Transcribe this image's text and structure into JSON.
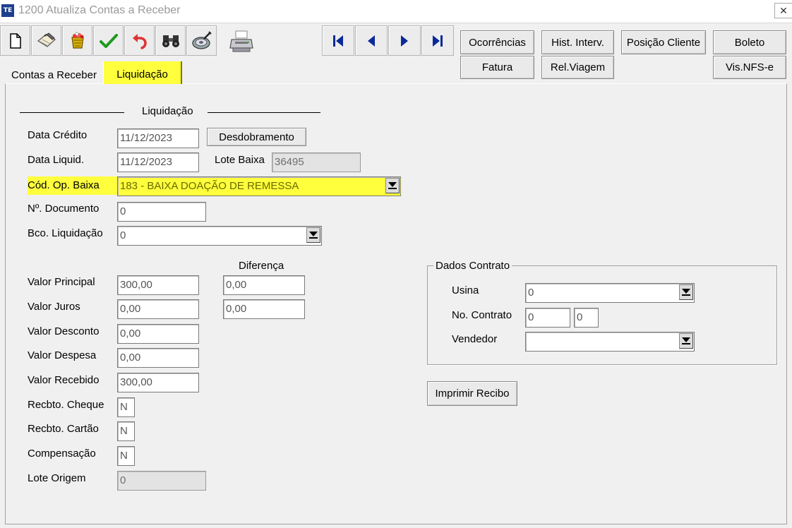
{
  "window": {
    "app_icon_text": "TE",
    "title": "1200 Atualiza Contas a Receber",
    "close_symbol": "✕"
  },
  "toolbar": {
    "icons": [
      "new-document-icon",
      "edit-notepad-icon",
      "delete-basket-icon",
      "confirm-check-icon",
      "undo-arrow-icon",
      "search-binoculars-icon",
      "cancel-disk-icon",
      "print-printer-icon"
    ],
    "nav_icons": [
      "first-record-icon",
      "previous-record-icon",
      "next-record-icon",
      "last-record-icon"
    ]
  },
  "actions": {
    "ocorrencias": "Ocorrências",
    "hist_interv": "Hist. Interv.",
    "posicao_cliente": "Posição Cliente",
    "boleto": "Boleto",
    "fatura": "Fatura",
    "rel_viagem": "Rel.Viagem",
    "vis_nfse": "Vis.NFS-e"
  },
  "tabs": {
    "contas": "Contas a Receber",
    "liquidacao": "Liquidação"
  },
  "liquidacao": {
    "section_title": "Liquidação",
    "data_credito_label": "Data Crédito",
    "data_credito": "11/12/2023",
    "desdobramento": "Desdobramento",
    "data_liquid_label": "Data Liquid.",
    "data_liquid": "11/12/2023",
    "lote_baixa_label": "Lote Baixa",
    "lote_baixa": "36495",
    "cod_op_label": "Cód. Op. Baixa",
    "cod_op": "183 - BAIXA DOAÇÃO DE REMESSA",
    "n_documento_label": "Nº. Documento",
    "n_documento": "0",
    "bco_label": "Bco. Liquidação",
    "bco": "0"
  },
  "valores": {
    "diferenca_label": "Diferença",
    "principal_label": "Valor Principal",
    "principal": "300,00",
    "dif_principal": "0,00",
    "juros_label": "Valor Juros",
    "juros": "0,00",
    "dif_juros": "0,00",
    "desconto_label": "Valor Desconto",
    "desconto": "0,00",
    "despesa_label": "Valor Despesa",
    "despesa": "0,00",
    "recebido_label": "Valor Recebido",
    "recebido": "300,00",
    "cheque_label": "Recbto. Cheque",
    "cheque": "N",
    "cartao_label": "Recbto. Cartão",
    "cartao": "N",
    "compensacao_label": "Compensação",
    "compensacao": "N",
    "lote_origem_label": "Lote Origem",
    "lote_origem": "0"
  },
  "contrato": {
    "title": "Dados Contrato",
    "usina_label": "Usina",
    "usina": "0",
    "no_contrato_label": "No. Contrato",
    "no_contrato_1": "0",
    "no_contrato_2": "0",
    "vendedor_label": "Vendedor",
    "vendedor": ""
  },
  "imprimir_recibo": "Imprimir Recibo",
  "colors": {
    "highlight": "#ffff3d"
  }
}
